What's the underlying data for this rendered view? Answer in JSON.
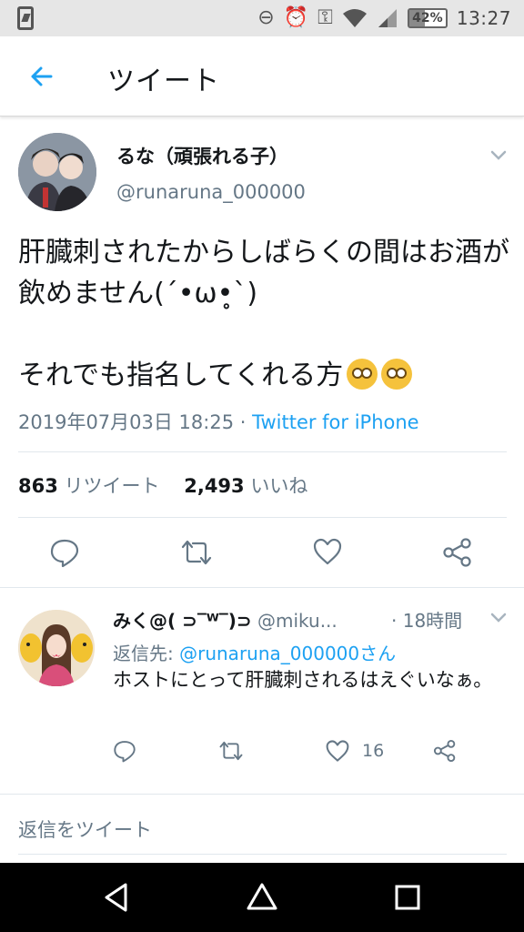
{
  "status_bar": {
    "battery": "42%",
    "time": "13:27"
  },
  "header": {
    "title": "ツイート"
  },
  "tweet": {
    "display_name": "るな（頑張れる子）",
    "handle": "@runaruna_000000",
    "text": "肝臓刺されたからしばらくの間はお酒が飲めません(´•ω•̥`)\n\nそれでも指名してくれる方",
    "emoji": [
      "rolling-eyes-emoji",
      "rolling-eyes-emoji"
    ],
    "date": "2019年07月03日 18:25 · ",
    "source": "Twitter for iPhone",
    "retweet_count": "863",
    "retweet_label": "リツイート",
    "like_count": "2,493",
    "like_label": "いいね"
  },
  "reply": {
    "display_name": "みく@( ⊃‾ᵂ‾)⊃",
    "handle": "@miku...",
    "time": "· 18時間",
    "reply_to_label": "返信先: ",
    "reply_to": "@runaruna_000000さん",
    "text": "ホストにとって肝臓刺されるはえぐいなぁ。",
    "like_count": "16"
  },
  "reply_box": {
    "placeholder": "返信をツイート"
  },
  "colors": {
    "accent": "#1da1f2",
    "secondary_text": "#657786",
    "text": "#14171a"
  }
}
